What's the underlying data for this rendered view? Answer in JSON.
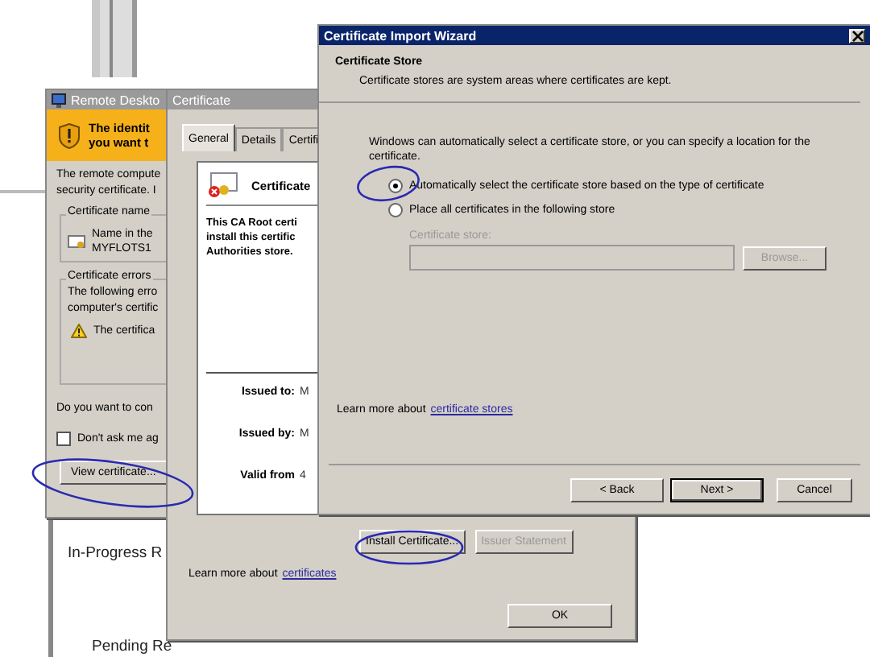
{
  "background": {
    "texts": [
      "In-Progress R",
      "Pending Re"
    ]
  },
  "remote_desktop": {
    "title": "Remote Deskto",
    "banner": [
      "The identit",
      "you want t"
    ],
    "intro": [
      "The remote compute",
      "security certificate. I"
    ],
    "certificate_name": {
      "legend": "Certificate name",
      "lines": [
        "Name in the",
        "MYFLOTS1"
      ]
    },
    "certificate_errors": {
      "legend": "Certificate errors",
      "lines": [
        "The following erro",
        "computer's certific"
      ],
      "warning": "The certifica"
    },
    "question": "Do you want to con",
    "dont_ask": {
      "label": "Don't ask me ag",
      "checked": false
    },
    "view_button": "View certificate..."
  },
  "certificate": {
    "title": "Certificate",
    "tabs": [
      {
        "label": "General",
        "selected": true
      },
      {
        "label": "Details",
        "selected": false
      },
      {
        "label": "Certifi",
        "selected": false
      }
    ],
    "heading": "Certificate",
    "message": [
      "This CA Root certi",
      "install this certific",
      "Authorities store."
    ],
    "fields": [
      {
        "label": "Issued to:",
        "value": "M"
      },
      {
        "label": "Issued by:",
        "value": "M"
      },
      {
        "label": "Valid from",
        "value": "4"
      }
    ],
    "buttons": [
      {
        "label": "Install Certificate...",
        "disabled": false
      },
      {
        "label": "Issuer Statement",
        "disabled": true
      }
    ],
    "learn_more": {
      "text": "Learn more about",
      "link": "certificates"
    },
    "ok": "OK"
  },
  "wizard": {
    "title": "Certificate Import Wizard",
    "header": "Certificate Store",
    "subtitle": "Certificate stores are system areas where certificates are kept.",
    "description": "Windows can automatically select a certificate store, or you can specify a location for the certificate.",
    "options": [
      {
        "label": "Automatically select the certificate store based on the type of certificate",
        "selected": true
      },
      {
        "label": "Place all certificates in the following store",
        "selected": false
      }
    ],
    "store": {
      "label": "Certificate store:",
      "disabled": true
    },
    "browse": {
      "label": "Browse...",
      "disabled": true
    },
    "learn_more": {
      "text": "Learn more about",
      "link": "certificate stores"
    },
    "buttons": [
      {
        "label": "< Back",
        "default": false
      },
      {
        "label": "Next >",
        "default": true
      },
      {
        "label": "Cancel",
        "default": false
      }
    ]
  }
}
